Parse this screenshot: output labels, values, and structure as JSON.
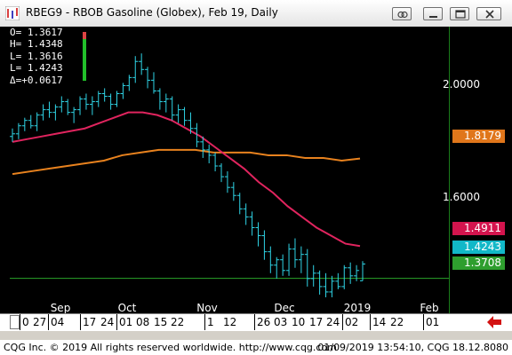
{
  "window": {
    "title": "RBEG9 - RBOB Gasoline (Globex), Feb 19, Daily"
  },
  "ohlc": {
    "open": "O= 1.3617",
    "high": "H= 1.4348",
    "low1": "L= 1.3616",
    "low2": "L= 1.4243",
    "delta": "Δ=+0.0617"
  },
  "price_axis": {
    "labels": [
      "2.0000",
      "1.6000"
    ]
  },
  "price_badges": [
    {
      "text": "1.8179",
      "color": "#e0761b"
    },
    {
      "text": "1.4911",
      "color": "#d4144e"
    },
    {
      "text": "1.4243",
      "color": "#12b8c8"
    },
    {
      "text": "1.3708",
      "color": "#2e9e2e"
    }
  ],
  "months": [
    "Sep",
    "Oct",
    "Nov",
    "Dec",
    "2019",
    "Feb"
  ],
  "days": [
    "0",
    "27",
    "04",
    "17",
    "24",
    "01",
    "08",
    "15",
    "22",
    "1",
    "12",
    "26",
    "03",
    "10",
    "17",
    "24",
    "02",
    "14",
    "22",
    "01"
  ],
  "footer": {
    "left": "CQG Inc. © 2019 All rights reserved worldwide. http://www.cqg.com",
    "right": "01/09/2019 13:54:10, CQG 18.12.8080"
  },
  "colors": {
    "background": "#000000",
    "bars": "#2fd4e6",
    "ma_fast": "#e0245e",
    "ma_slow": "#e8821e",
    "reference_line": "#2aa52a"
  },
  "chart_data": {
    "type": "line",
    "title": "RBEG9 - RBOB Gasoline (Globex), Feb 19, Daily",
    "xlabel": "",
    "ylabel": "",
    "ylim": [
      1.29,
      2.31
    ],
    "x_months": [
      "Sep",
      "Oct",
      "Nov",
      "Dec",
      "2019",
      "Feb"
    ],
    "series": [
      {
        "type": "ohlc",
        "values": [
          [
            1.9,
            1.93,
            1.88,
            1.91
          ],
          [
            1.91,
            1.95,
            1.89,
            1.94
          ],
          [
            1.94,
            1.97,
            1.92,
            1.96
          ],
          [
            1.96,
            1.98,
            1.93,
            1.94
          ],
          [
            1.94,
            1.99,
            1.92,
            1.98
          ],
          [
            1.98,
            2.02,
            1.96,
            2.0
          ],
          [
            2.0,
            2.03,
            1.97,
            1.99
          ],
          [
            1.99,
            2.02,
            1.96,
            2.01
          ],
          [
            2.01,
            2.05,
            1.99,
            2.03
          ],
          [
            2.03,
            2.04,
            1.98,
            1.99
          ],
          [
            1.99,
            2.01,
            1.95,
            2.0
          ],
          [
            2.0,
            2.05,
            1.98,
            2.04
          ],
          [
            2.04,
            2.06,
            2.0,
            2.02
          ],
          [
            2.02,
            2.05,
            1.98,
            2.03
          ],
          [
            2.03,
            2.07,
            2.01,
            2.06
          ],
          [
            2.06,
            2.08,
            2.03,
            2.05
          ],
          [
            2.05,
            2.06,
            2.0,
            2.02
          ],
          [
            2.02,
            2.07,
            2.01,
            2.06
          ],
          [
            2.06,
            2.1,
            2.04,
            2.09
          ],
          [
            2.09,
            2.13,
            2.07,
            2.12
          ],
          [
            2.12,
            2.2,
            2.1,
            2.18
          ],
          [
            2.18,
            2.21,
            2.13,
            2.15
          ],
          [
            2.15,
            2.16,
            2.08,
            2.11
          ],
          [
            2.11,
            2.14,
            2.06,
            2.07
          ],
          [
            2.07,
            2.08,
            2.0,
            2.03
          ],
          [
            2.03,
            2.06,
            1.99,
            2.04
          ],
          [
            2.04,
            2.05,
            1.96,
            1.98
          ],
          [
            1.98,
            2.02,
            1.95,
            2.0
          ],
          [
            2.0,
            2.01,
            1.94,
            1.96
          ],
          [
            1.96,
            1.99,
            1.91,
            1.93
          ],
          [
            1.93,
            1.95,
            1.86,
            1.88
          ],
          [
            1.88,
            1.9,
            1.82,
            1.85
          ],
          [
            1.85,
            1.87,
            1.8,
            1.83
          ],
          [
            1.83,
            1.84,
            1.77,
            1.79
          ],
          [
            1.79,
            1.8,
            1.73,
            1.75
          ],
          [
            1.75,
            1.77,
            1.69,
            1.71
          ],
          [
            1.71,
            1.73,
            1.66,
            1.68
          ],
          [
            1.68,
            1.69,
            1.61,
            1.63
          ],
          [
            1.63,
            1.65,
            1.57,
            1.6
          ],
          [
            1.6,
            1.62,
            1.53,
            1.56
          ],
          [
            1.56,
            1.58,
            1.49,
            1.53
          ],
          [
            1.53,
            1.55,
            1.44,
            1.47
          ],
          [
            1.47,
            1.49,
            1.39,
            1.42
          ],
          [
            1.42,
            1.45,
            1.37,
            1.44
          ],
          [
            1.44,
            1.46,
            1.38,
            1.4
          ],
          [
            1.4,
            1.5,
            1.38,
            1.48
          ],
          [
            1.48,
            1.52,
            1.41,
            1.44
          ],
          [
            1.44,
            1.49,
            1.39,
            1.46
          ],
          [
            1.46,
            1.48,
            1.34,
            1.37
          ],
          [
            1.37,
            1.42,
            1.34,
            1.39
          ],
          [
            1.39,
            1.4,
            1.31,
            1.34
          ],
          [
            1.34,
            1.39,
            1.3,
            1.32
          ],
          [
            1.32,
            1.38,
            1.3,
            1.36
          ],
          [
            1.36,
            1.39,
            1.33,
            1.34
          ],
          [
            1.34,
            1.42,
            1.33,
            1.41
          ],
          [
            1.41,
            1.43,
            1.35,
            1.38
          ],
          [
            1.38,
            1.42,
            1.36,
            1.4
          ],
          [
            1.3617,
            1.4348,
            1.3616,
            1.4243
          ]
        ]
      },
      {
        "name": "",
        "type": "line",
        "values": [
          1.88,
          1.89,
          1.9,
          1.91,
          1.92,
          1.93,
          1.95,
          1.97,
          1.99,
          1.99,
          1.98,
          1.96,
          1.93,
          1.9,
          1.86,
          1.82,
          1.78,
          1.73,
          1.69,
          1.64,
          1.6,
          1.56,
          1.53,
          1.5,
          1.4911
        ]
      },
      {
        "name": "",
        "type": "line",
        "values": [
          1.76,
          1.77,
          1.78,
          1.79,
          1.8,
          1.81,
          1.83,
          1.84,
          1.85,
          1.85,
          1.85,
          1.84,
          1.84,
          1.84,
          1.83,
          1.83,
          1.82,
          1.82,
          1.81,
          1.8179
        ]
      },
      {
        "name": "",
        "type": "hline",
        "values": [
          1.3708
        ]
      }
    ]
  }
}
